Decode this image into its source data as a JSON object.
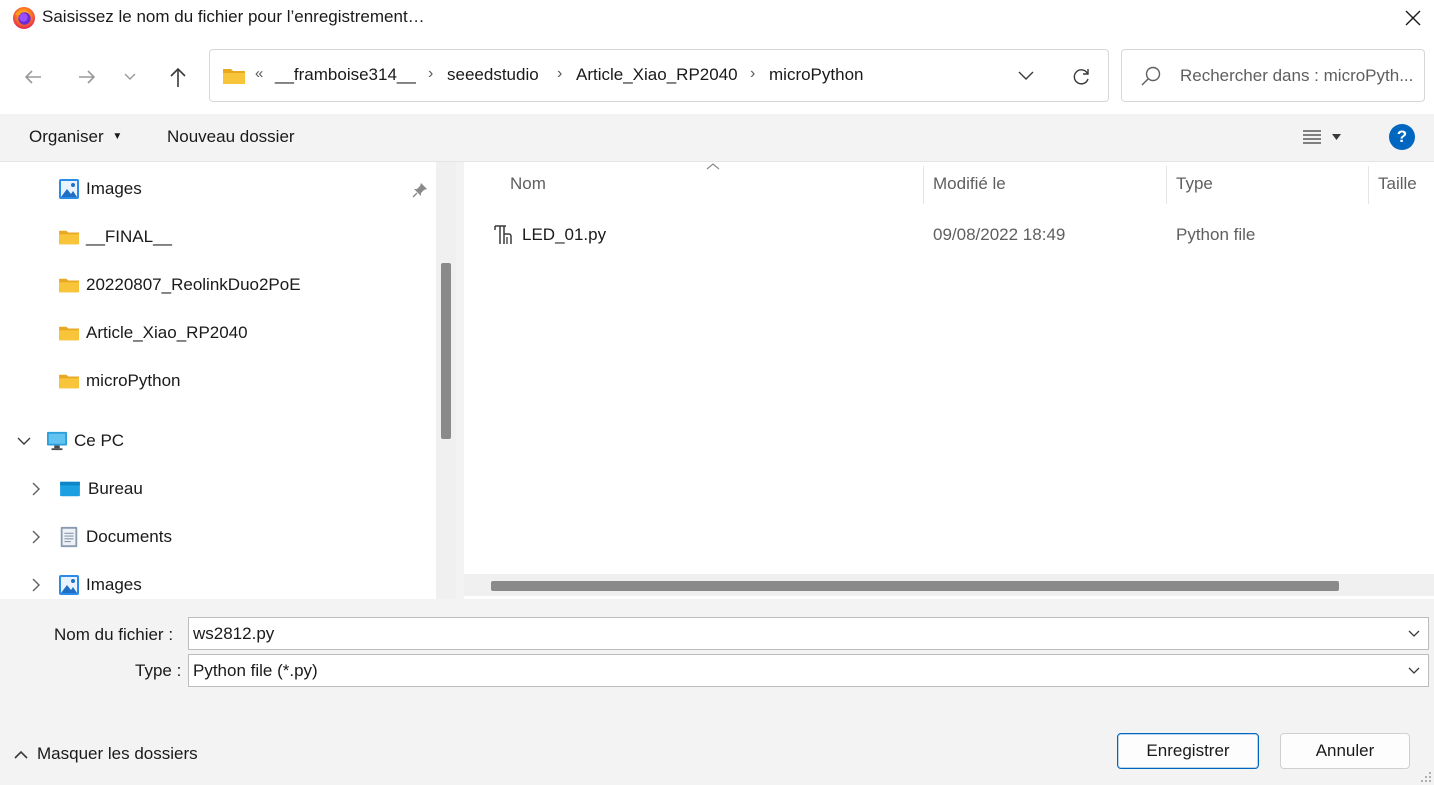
{
  "window": {
    "title": "Saisissez le nom du fichier pour l’enregistrement…"
  },
  "address": {
    "overflow": "«",
    "crumbs": [
      "__framboise314__",
      "seeedstudio",
      "Article_Xiao_RP2040",
      "microPython"
    ]
  },
  "search": {
    "placeholder": "Rechercher dans : microPyth..."
  },
  "toolbar": {
    "organiser_label": "Organiser",
    "new_folder_label": "Nouveau dossier",
    "help_label": "?"
  },
  "nav": {
    "items": [
      {
        "label": "Images",
        "icon": "pictures-icon",
        "pinned": true
      },
      {
        "label": "__FINAL__",
        "icon": "folder-icon"
      },
      {
        "label": "20220807_ReolinkDuo2PoE",
        "icon": "folder-icon"
      },
      {
        "label": "Article_Xiao_RP2040",
        "icon": "folder-icon"
      },
      {
        "label": "microPython",
        "icon": "folder-icon"
      },
      {
        "label": "Ce PC",
        "icon": "computer-icon",
        "expanded": true
      },
      {
        "label": "Bureau",
        "icon": "desktop-icon"
      },
      {
        "label": "Documents",
        "icon": "documents-icon"
      },
      {
        "label": "Images",
        "icon": "pictures-icon"
      }
    ]
  },
  "filelist": {
    "columns": [
      "Nom",
      "Modifié le",
      "Type",
      "Taille"
    ],
    "rows": [
      {
        "name": "LED_01.py",
        "modified": "09/08/2022 18:49",
        "type": "Python file"
      }
    ]
  },
  "form": {
    "filename_label": "Nom du fichier :",
    "filename_value": "ws2812.py",
    "type_label": "Type :",
    "type_value": "Python file (*.py)"
  },
  "footer": {
    "hide_folders_label": "Masquer les dossiers",
    "save_label": "Enregistrer",
    "cancel_label": "Annuler"
  },
  "colors": {
    "accent": "#0067c0",
    "folder": "#f8c53a",
    "commandbar_bg": "#f3f3f3"
  }
}
